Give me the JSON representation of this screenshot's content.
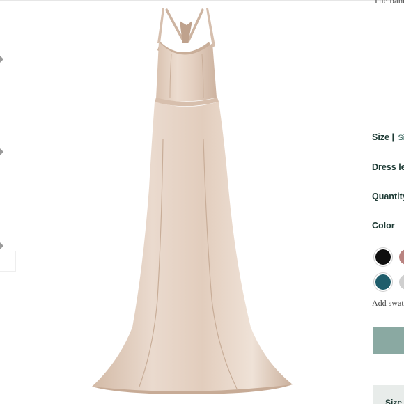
{
  "description": {
    "cropped_text": "The bane"
  },
  "options": {
    "size_label": "Size |",
    "size_guide_link": "Size",
    "dress_length_label": "Dress ler",
    "quantity_label": "Quantity",
    "color_label": "Color"
  },
  "swatches": [
    {
      "name": "black",
      "color": "#0f0f0f",
      "selected": true
    },
    {
      "name": "rose",
      "color": "#b98380",
      "selected": false
    },
    {
      "name": "teal",
      "color": "#1f5d6b",
      "selected": true
    },
    {
      "name": "silver",
      "color": "#cfcfcf",
      "selected": false
    }
  ],
  "add_swatches_text": "Add swat",
  "bottom_tab_label": "Size",
  "colors": {
    "accent_dark_green": "#1d3a34",
    "button_sage": "#8aa9a2",
    "dress_champagne": "#e6d2c3"
  },
  "product_image": {
    "icon": "dress-image"
  }
}
